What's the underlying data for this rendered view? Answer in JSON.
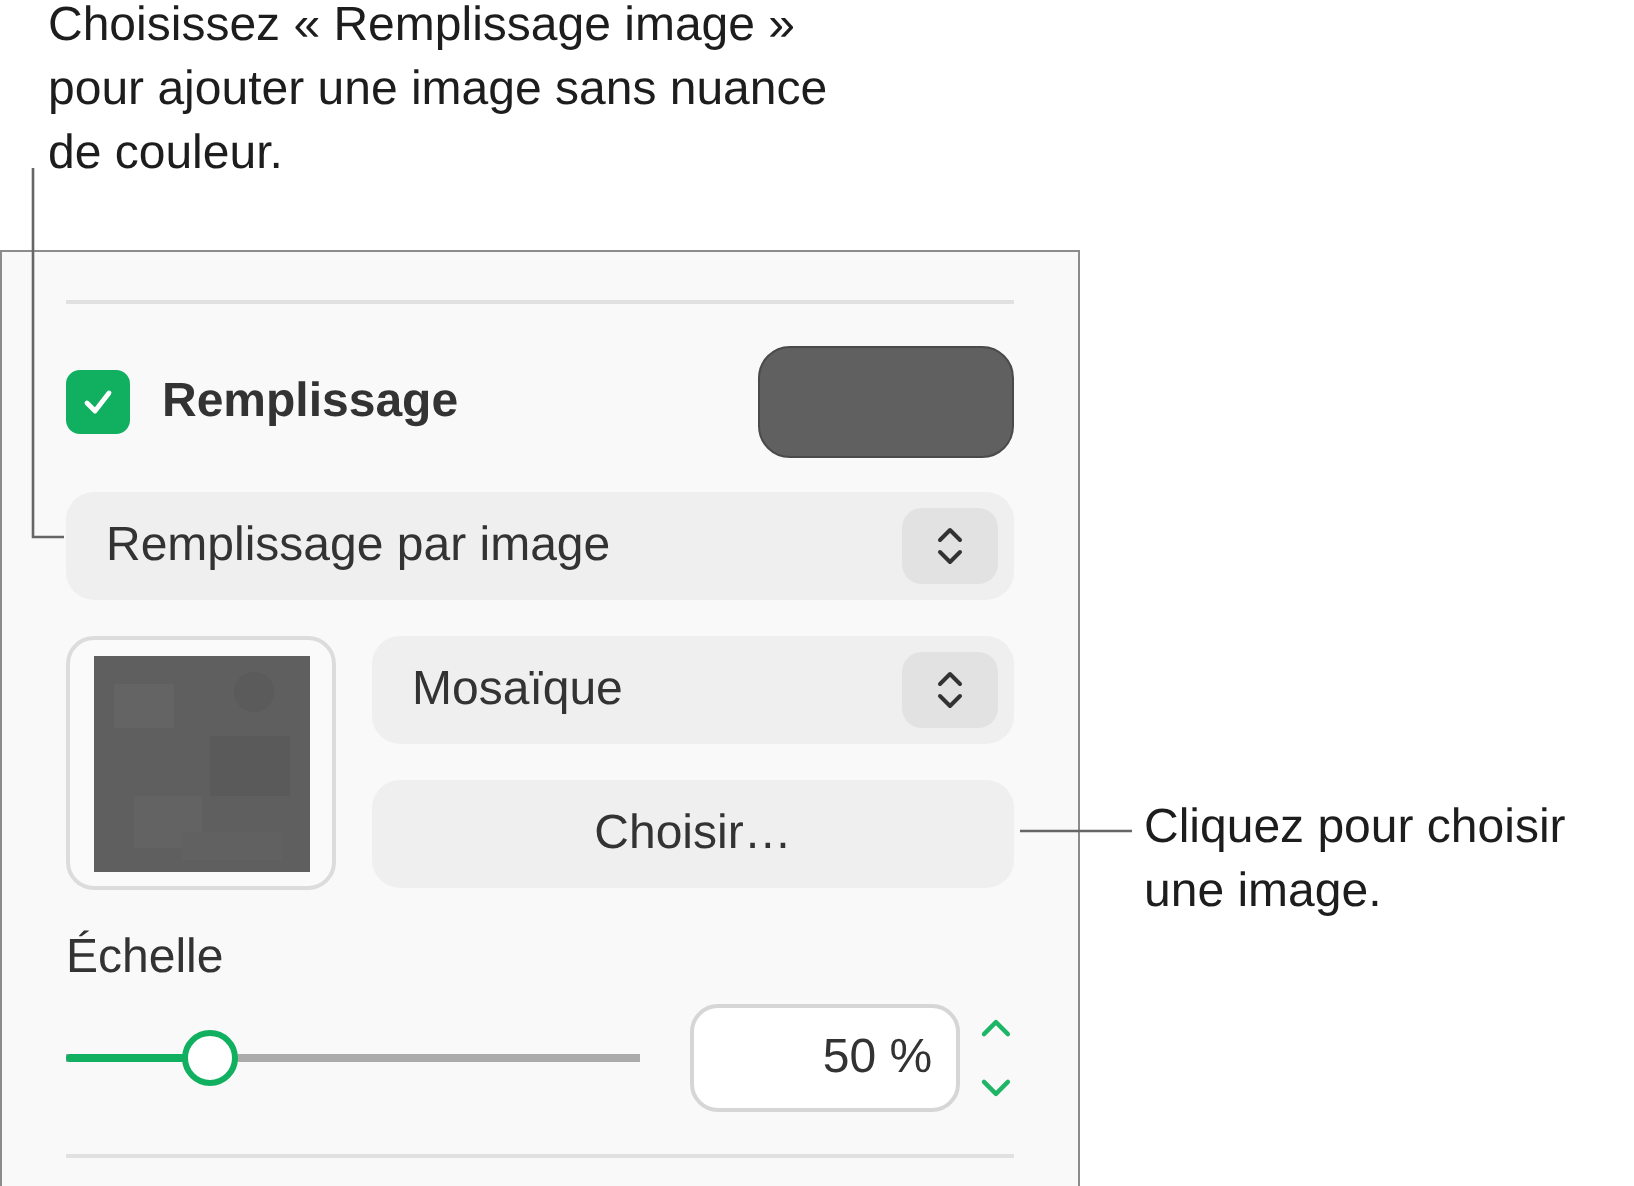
{
  "callouts": [
    {
      "text": "Choisissez « Remplissage image » pour ajouter une image sans nuance de couleur."
    },
    {
      "text": "Cliquez pour choisir une image."
    }
  ],
  "fill": {
    "label": "Remplissage",
    "checked": true
  },
  "fill_type": {
    "value": "Remplissage par image"
  },
  "scale_mode": {
    "value": "Mosaïque"
  },
  "choose_button": "Choisir…",
  "scale": {
    "label": "Échelle",
    "level": 0.24,
    "value": "50 %"
  }
}
